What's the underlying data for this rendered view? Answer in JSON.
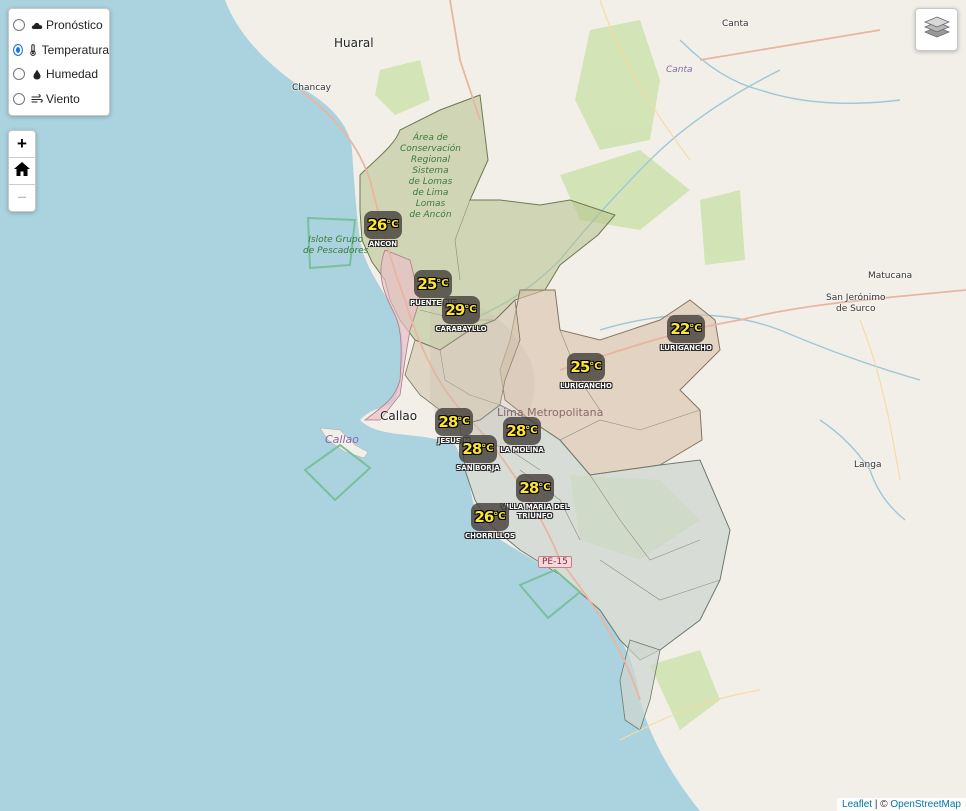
{
  "layer_options": [
    {
      "label": "Pronóstico",
      "icon": "cloud-icon",
      "checked": false
    },
    {
      "label": "Temperatura",
      "icon": "thermometer-icon",
      "checked": true
    },
    {
      "label": "Humedad",
      "icon": "droplet-icon",
      "checked": false
    },
    {
      "label": "Viento",
      "icon": "wind-icon",
      "checked": false
    }
  ],
  "zoom": {
    "in": "+",
    "home_icon": "home-icon",
    "out": "−"
  },
  "layers_toggle_icon": "layers-icon",
  "map_labels": {
    "huaral": "Huaral",
    "chancay": "Chancay",
    "canta": "Canta",
    "canta_river": "Canta",
    "matucana": "Matucana",
    "san_jeronimo": "San Jerónimo\nde Surco",
    "langa": "Langa",
    "callao_city": "Callao",
    "callao_island": "Callao",
    "lima_metro": "Lima Metropolitana",
    "islote": "Islote Grupo\nde Pescadores",
    "area_conservacion": "Área de\nConservación\nRegional\nSistema\nde Lomas\nde Lima\nLomas\nde Ancón",
    "pe15": "PE-15"
  },
  "markers": [
    {
      "temp": "26",
      "unit": "°C",
      "district": "ANCON"
    },
    {
      "temp": "25",
      "unit": "°C",
      "district": "PUENTE PIE"
    },
    {
      "temp": "29",
      "unit": "°C",
      "district": "CARABAYLLO"
    },
    {
      "temp": "22",
      "unit": "°C",
      "district": "LURIGANCHO"
    },
    {
      "temp": "25",
      "unit": "°C",
      "district": "LURIGANCHO"
    },
    {
      "temp": "28",
      "unit": "°C",
      "district": "JESUS M"
    },
    {
      "temp": "28",
      "unit": "°C",
      "district": "LA MOLINA"
    },
    {
      "temp": "28",
      "unit": "°C",
      "district": "SAN BORJA"
    },
    {
      "temp": "28",
      "unit": "°C",
      "district": "VILLA MARIA DEL\nTRIUNFO"
    },
    {
      "temp": "26",
      "unit": "°C",
      "district": "CHORRILLOS"
    }
  ],
  "attribution": {
    "leaflet": "Leaflet",
    "sep": " | © ",
    "osm": "OpenStreetMap"
  },
  "colors": {
    "sea": "#aad3df",
    "land": "#f2efe9",
    "north_region": "#b5c18a",
    "east_region": "#d9c0a8",
    "south_region": "#cfd6cf",
    "callao_region": "#e8bfc8",
    "badge_text": "#ffe62e"
  }
}
